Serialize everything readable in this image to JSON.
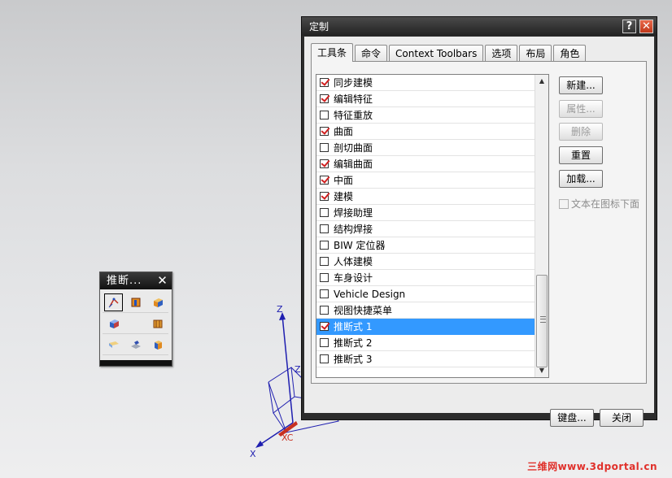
{
  "floating_toolbar": {
    "title": "推断...",
    "close_glyph": "✕",
    "icons": [
      "infer-selected-icon",
      "infer-face-icon",
      "infer-block-icon",
      "infer-cube-icon",
      "empty",
      "infer-panel-icon",
      "infer-sheet-icon",
      "infer-plane-icon",
      "infer-solid-icon"
    ]
  },
  "axes": {
    "z_label": "Z",
    "z_label_small": "Z",
    "x_label": "X",
    "xc_label": "XC"
  },
  "dialog": {
    "title": "定制",
    "help_glyph": "?",
    "close_glyph": "✕",
    "tabs": [
      "工具条",
      "命令",
      "Context Toolbars",
      "选项",
      "布局",
      "角色"
    ],
    "active_tab": "工具条",
    "toolbar_list": [
      {
        "label": "同步建模",
        "checked": true
      },
      {
        "label": "编辑特征",
        "checked": true
      },
      {
        "label": "特征重放",
        "checked": false
      },
      {
        "label": "曲面",
        "checked": true
      },
      {
        "label": "剖切曲面",
        "checked": false
      },
      {
        "label": "编辑曲面",
        "checked": true
      },
      {
        "label": "中面",
        "checked": true
      },
      {
        "label": "建模",
        "checked": true
      },
      {
        "label": "焊接助理",
        "checked": false
      },
      {
        "label": "结构焊接",
        "checked": false
      },
      {
        "label": "BIW 定位器",
        "checked": false
      },
      {
        "label": "人体建模",
        "checked": false
      },
      {
        "label": "车身设计",
        "checked": false
      },
      {
        "label": "Vehicle Design",
        "checked": false
      },
      {
        "label": "视图快捷菜单",
        "checked": false
      },
      {
        "label": "推断式 1",
        "checked": true,
        "selected": true
      },
      {
        "label": "推断式 2",
        "checked": false
      },
      {
        "label": "推断式 3",
        "checked": false
      }
    ],
    "buttons": {
      "new": "新建...",
      "properties": "属性...",
      "delete": "删除",
      "reset": "重置",
      "load": "加载..."
    },
    "text_below_icon": "文本在图标下面",
    "footer": {
      "keyboard": "键盘...",
      "close": "关闭"
    }
  },
  "watermark": "三维网www.3dportal.cn",
  "colors": {
    "selection": "#3399ff",
    "check": "#d02020",
    "axis_blue": "#1f1fb0",
    "axis_red": "#c83020"
  }
}
